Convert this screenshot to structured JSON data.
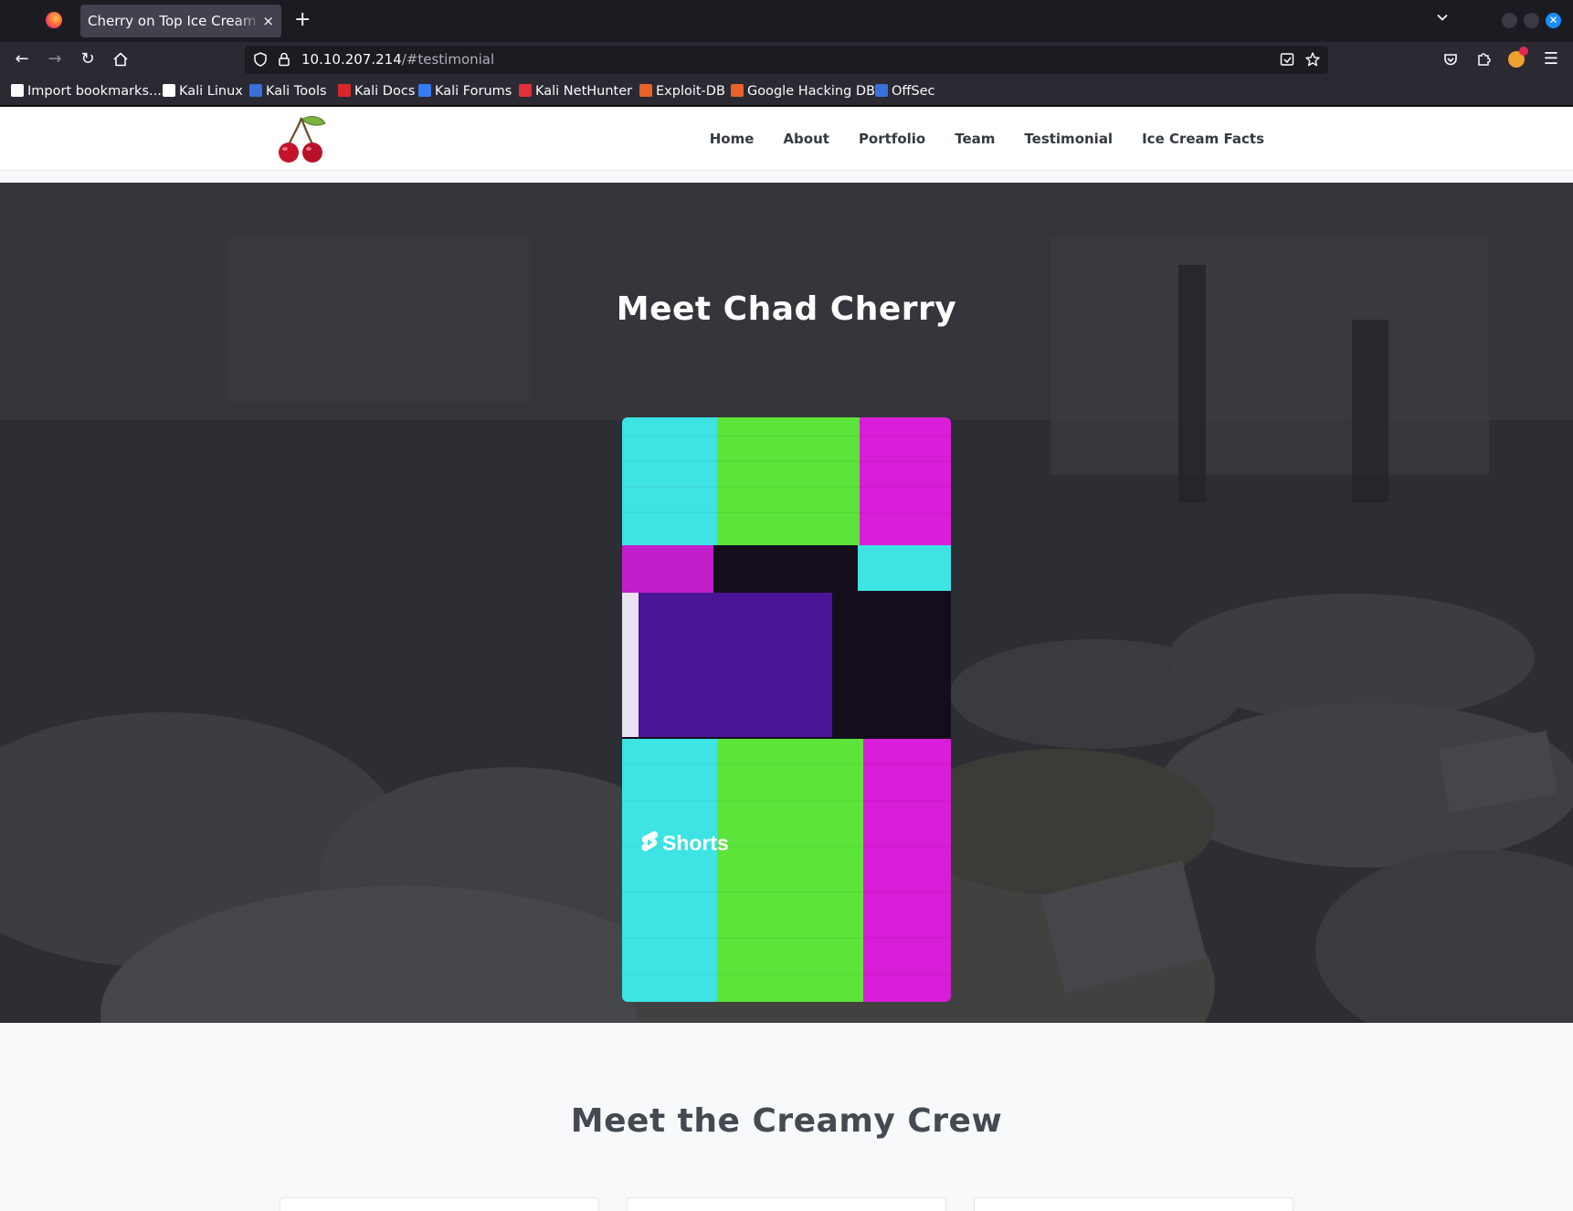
{
  "browser": {
    "tab_title": "Cherry on Top Ice Cream Shop",
    "tab_close": "×",
    "new_tab": "+",
    "url_host": "10.10.207.214",
    "url_path": "/#testimonial"
  },
  "bookmarks": [
    {
      "label": "Import bookmarks...",
      "icon": "import-icon",
      "color": "#fbfbfe"
    },
    {
      "label": "Kali Linux",
      "icon": "kali-dragon-icon",
      "color": "#ffffff"
    },
    {
      "label": "Kali Tools",
      "icon": "kali-tools-icon",
      "color": "#3a6fd8"
    },
    {
      "label": "Kali Docs",
      "icon": "kali-docs-icon",
      "color": "#d9262b"
    },
    {
      "label": "Kali Forums",
      "icon": "kali-forums-icon",
      "color": "#367bf0"
    },
    {
      "label": "Kali NetHunter",
      "icon": "nethunter-icon",
      "color": "#e0303a"
    },
    {
      "label": "Exploit-DB",
      "icon": "exploit-db-icon",
      "color": "#e8622a"
    },
    {
      "label": "Google Hacking DB",
      "icon": "ghdb-icon",
      "color": "#e8622a"
    },
    {
      "label": "OffSec",
      "icon": "offsec-icon",
      "color": "#3a6fd8"
    }
  ],
  "site": {
    "nav": [
      "Home",
      "About",
      "Portfolio",
      "Team",
      "Testimonial",
      "Ice Cream Facts"
    ],
    "hero_title": "Meet Chad Cherry",
    "video_badge": "Shorts",
    "crew_title": "Meet the Creamy Crew"
  }
}
